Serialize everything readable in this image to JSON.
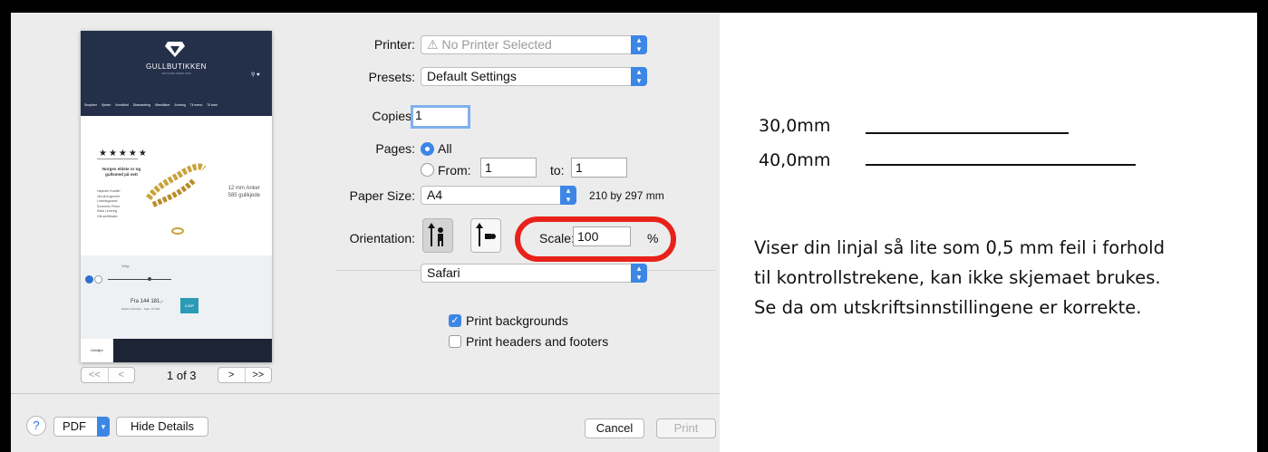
{
  "dialog": {
    "printer_label": "Printer:",
    "printer_value": "No Printer Selected",
    "presets_label": "Presets:",
    "presets_value": "Default Settings",
    "copies_label": "Copies:",
    "copies_value": "1",
    "pages_label": "Pages:",
    "pages_all": "All",
    "pages_from_label": "From:",
    "pages_from_value": "1",
    "pages_to_label": "to:",
    "pages_to_value": "1",
    "paper_size_label": "Paper Size:",
    "paper_size_value": "A4",
    "paper_size_dims": "210 by 297 mm",
    "orientation_label": "Orientation:",
    "scale_label": "Scale:",
    "scale_value": "100",
    "scale_unit": "%",
    "section_value": "Safari",
    "print_backgrounds": "Print backgrounds",
    "print_headers_footers": "Print headers and footers",
    "page_count": "1 of 3",
    "nav_first": "<<",
    "nav_prev": "<",
    "nav_next": ">",
    "nav_last": ">>",
    "help_label": "?",
    "pdf_label": "PDF",
    "hide_details": "Hide Details",
    "cancel": "Cancel",
    "print": "Print",
    "highlight_color": "#e8221b",
    "accent_color": "#3c86e6"
  },
  "preview": {
    "brand": "GULLBUTIKKEN",
    "tagline": "SMYKKER SIDEN 1950",
    "nav": [
      "Smykker",
      "Kjeder",
      "Armbånd",
      "Diamantring",
      "Ørestikker",
      "Anheng",
      "Til menn",
      "Til barn"
    ],
    "stars": "★★★★★",
    "heading": "Norges eldste nr og gullsmed på nett",
    "product": "12 mm Anker\n585 gullkjede",
    "bullets": [
      "Høyeste Kvalitet",
      "Ubrutt Angrerett",
      "Livstidsgaranti",
      "Suverene Priser",
      "Rask Levering",
      "Gift-sertifikater"
    ],
    "velg": "Velg:",
    "price": "Fra 144 181,-",
    "price_sub": "Mellom 200 KRL · Spar: 15 KRL",
    "buy": "KJØP",
    "tab": "Detaljer"
  },
  "ruler": {
    "mark_30": "30,0mm",
    "mark_40": "40,0mm",
    "note_lines": [
      "Viser din linjal så lite som 0,5 mm feil i forhold",
      "til kontrollstrekene, kan ikke skjemaet brukes.",
      "Se da om utskriftsinnstillingene er korrekte."
    ]
  }
}
